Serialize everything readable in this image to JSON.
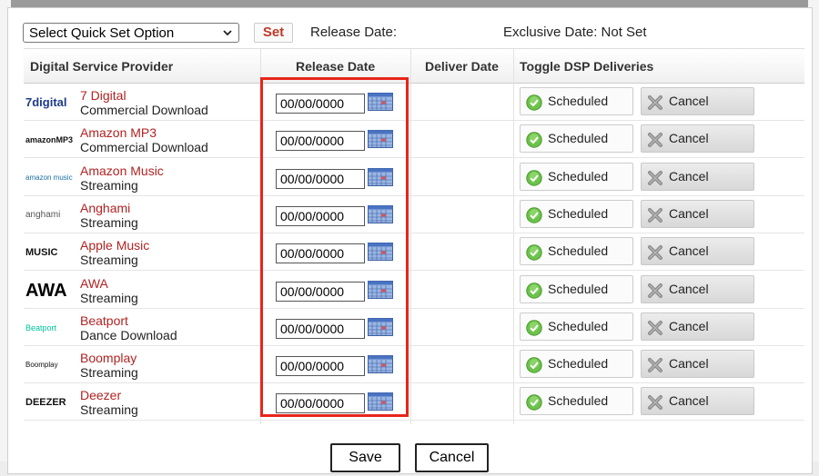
{
  "toolbar": {
    "quick_set_value": "Select Quick Set Option",
    "set_label": "Set",
    "release_date_label": "Release Date:",
    "exclusive_date_label": "Exclusive Date: Not Set"
  },
  "columns": [
    "Digital Service Provider",
    "Release Date",
    "Deliver Date",
    "Toggle DSP Deliveries"
  ],
  "rows": [
    {
      "name": "7 Digital",
      "type": "Commercial Download",
      "logo": "7digital",
      "release_date": "00/00/0000",
      "status": "Scheduled",
      "cancel": "Cancel"
    },
    {
      "name": "Amazon MP3",
      "type": "Commercial Download",
      "logo": "amazonMP3",
      "release_date": "00/00/0000",
      "status": "Scheduled",
      "cancel": "Cancel"
    },
    {
      "name": "Amazon Music",
      "type": "Streaming",
      "logo": "amazon music",
      "release_date": "00/00/0000",
      "status": "Scheduled",
      "cancel": "Cancel"
    },
    {
      "name": "Anghami",
      "type": "Streaming",
      "logo": "anghami",
      "release_date": "00/00/0000",
      "status": "Scheduled",
      "cancel": "Cancel"
    },
    {
      "name": "Apple Music",
      "type": "Streaming",
      "logo": "MUSIC",
      "release_date": "00/00/0000",
      "status": "Scheduled",
      "cancel": "Cancel"
    },
    {
      "name": "AWA",
      "type": "Streaming",
      "logo": "AWA",
      "release_date": "00/00/0000",
      "status": "Scheduled",
      "cancel": "Cancel"
    },
    {
      "name": "Beatport",
      "type": "Dance Download",
      "logo": "Beatport",
      "release_date": "00/00/0000",
      "status": "Scheduled",
      "cancel": "Cancel"
    },
    {
      "name": "Boomplay",
      "type": "Streaming",
      "logo": "Boomplay",
      "release_date": "00/00/0000",
      "status": "Scheduled",
      "cancel": "Cancel"
    },
    {
      "name": "Deezer",
      "type": "Streaming",
      "logo": "DEEZER",
      "release_date": "00/00/0000",
      "status": "Scheduled",
      "cancel": "Cancel"
    }
  ],
  "footer": {
    "save_label": "Save",
    "cancel_label": "Cancel"
  },
  "colors": {
    "accent_red": "#e8251c",
    "provider_name": "#b22222",
    "check_green": "#4caf28"
  }
}
